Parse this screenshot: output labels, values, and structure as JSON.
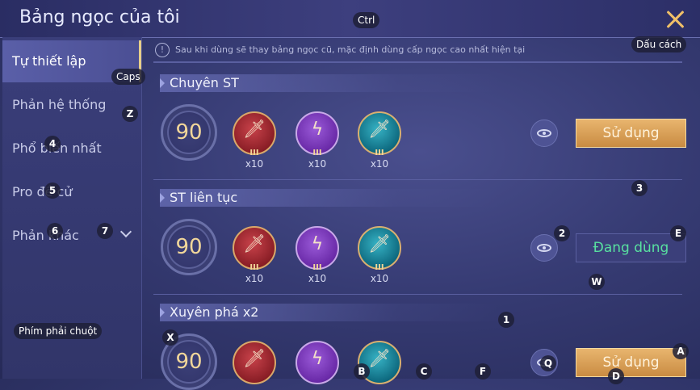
{
  "header": {
    "title": "Bảng ngọc của tôi",
    "close_icon": "close-icon"
  },
  "sidebar": {
    "items": [
      {
        "label": "Tự thiết lập",
        "active": true
      },
      {
        "label": "Phản hệ thống"
      },
      {
        "label": "Phổ biến nhất"
      },
      {
        "label": "Pro đề cử"
      },
      {
        "label": "Phản khác"
      }
    ]
  },
  "notice": {
    "text": "Sau khi dùng sẽ thay bảng ngọc cũ, mặc định dùng cấp ngọc cao nhất hiện tại"
  },
  "pages": [
    {
      "title": "Chuyên ST",
      "level": "90",
      "gems": [
        {
          "rank": "III",
          "count": "x10",
          "color": "#b8323a"
        },
        {
          "rank": "III",
          "count": "x10",
          "color": "#7a3cc2"
        },
        {
          "rank": "III",
          "count": "x10",
          "color": "#1a8a9e"
        }
      ],
      "action": "Sử dụng"
    },
    {
      "title": "ST liên tục",
      "level": "90",
      "gems": [
        {
          "rank": "III",
          "count": "x10",
          "color": "#b8323a"
        },
        {
          "rank": "III",
          "count": "x10",
          "color": "#7a3cc2"
        },
        {
          "rank": "III",
          "count": "x10",
          "color": "#1a8a9e"
        }
      ],
      "action": "Đang dùng"
    },
    {
      "title": "Xuyên phá x2",
      "level": "90",
      "gems": [
        {
          "rank": "",
          "count": "",
          "color": "#b8323a"
        },
        {
          "rank": "",
          "count": "",
          "color": "#7a3cc2"
        },
        {
          "rank": "",
          "count": "",
          "color": "#1a8a9e"
        }
      ],
      "action": "Sử dụng"
    }
  ],
  "key_hints": {
    "ctrl": "Ctrl",
    "space": "Dấu cách",
    "caps": "Caps",
    "z": "Z",
    "four": "4",
    "five": "5",
    "six": "6",
    "seven": "7",
    "three": "3",
    "two": "2",
    "e": "E",
    "w": "W",
    "one": "1",
    "rmb": "Phím phải chuột",
    "x": "X",
    "a": "A",
    "q": "Q",
    "b": "B",
    "c": "C",
    "f": "F",
    "d": "D"
  }
}
